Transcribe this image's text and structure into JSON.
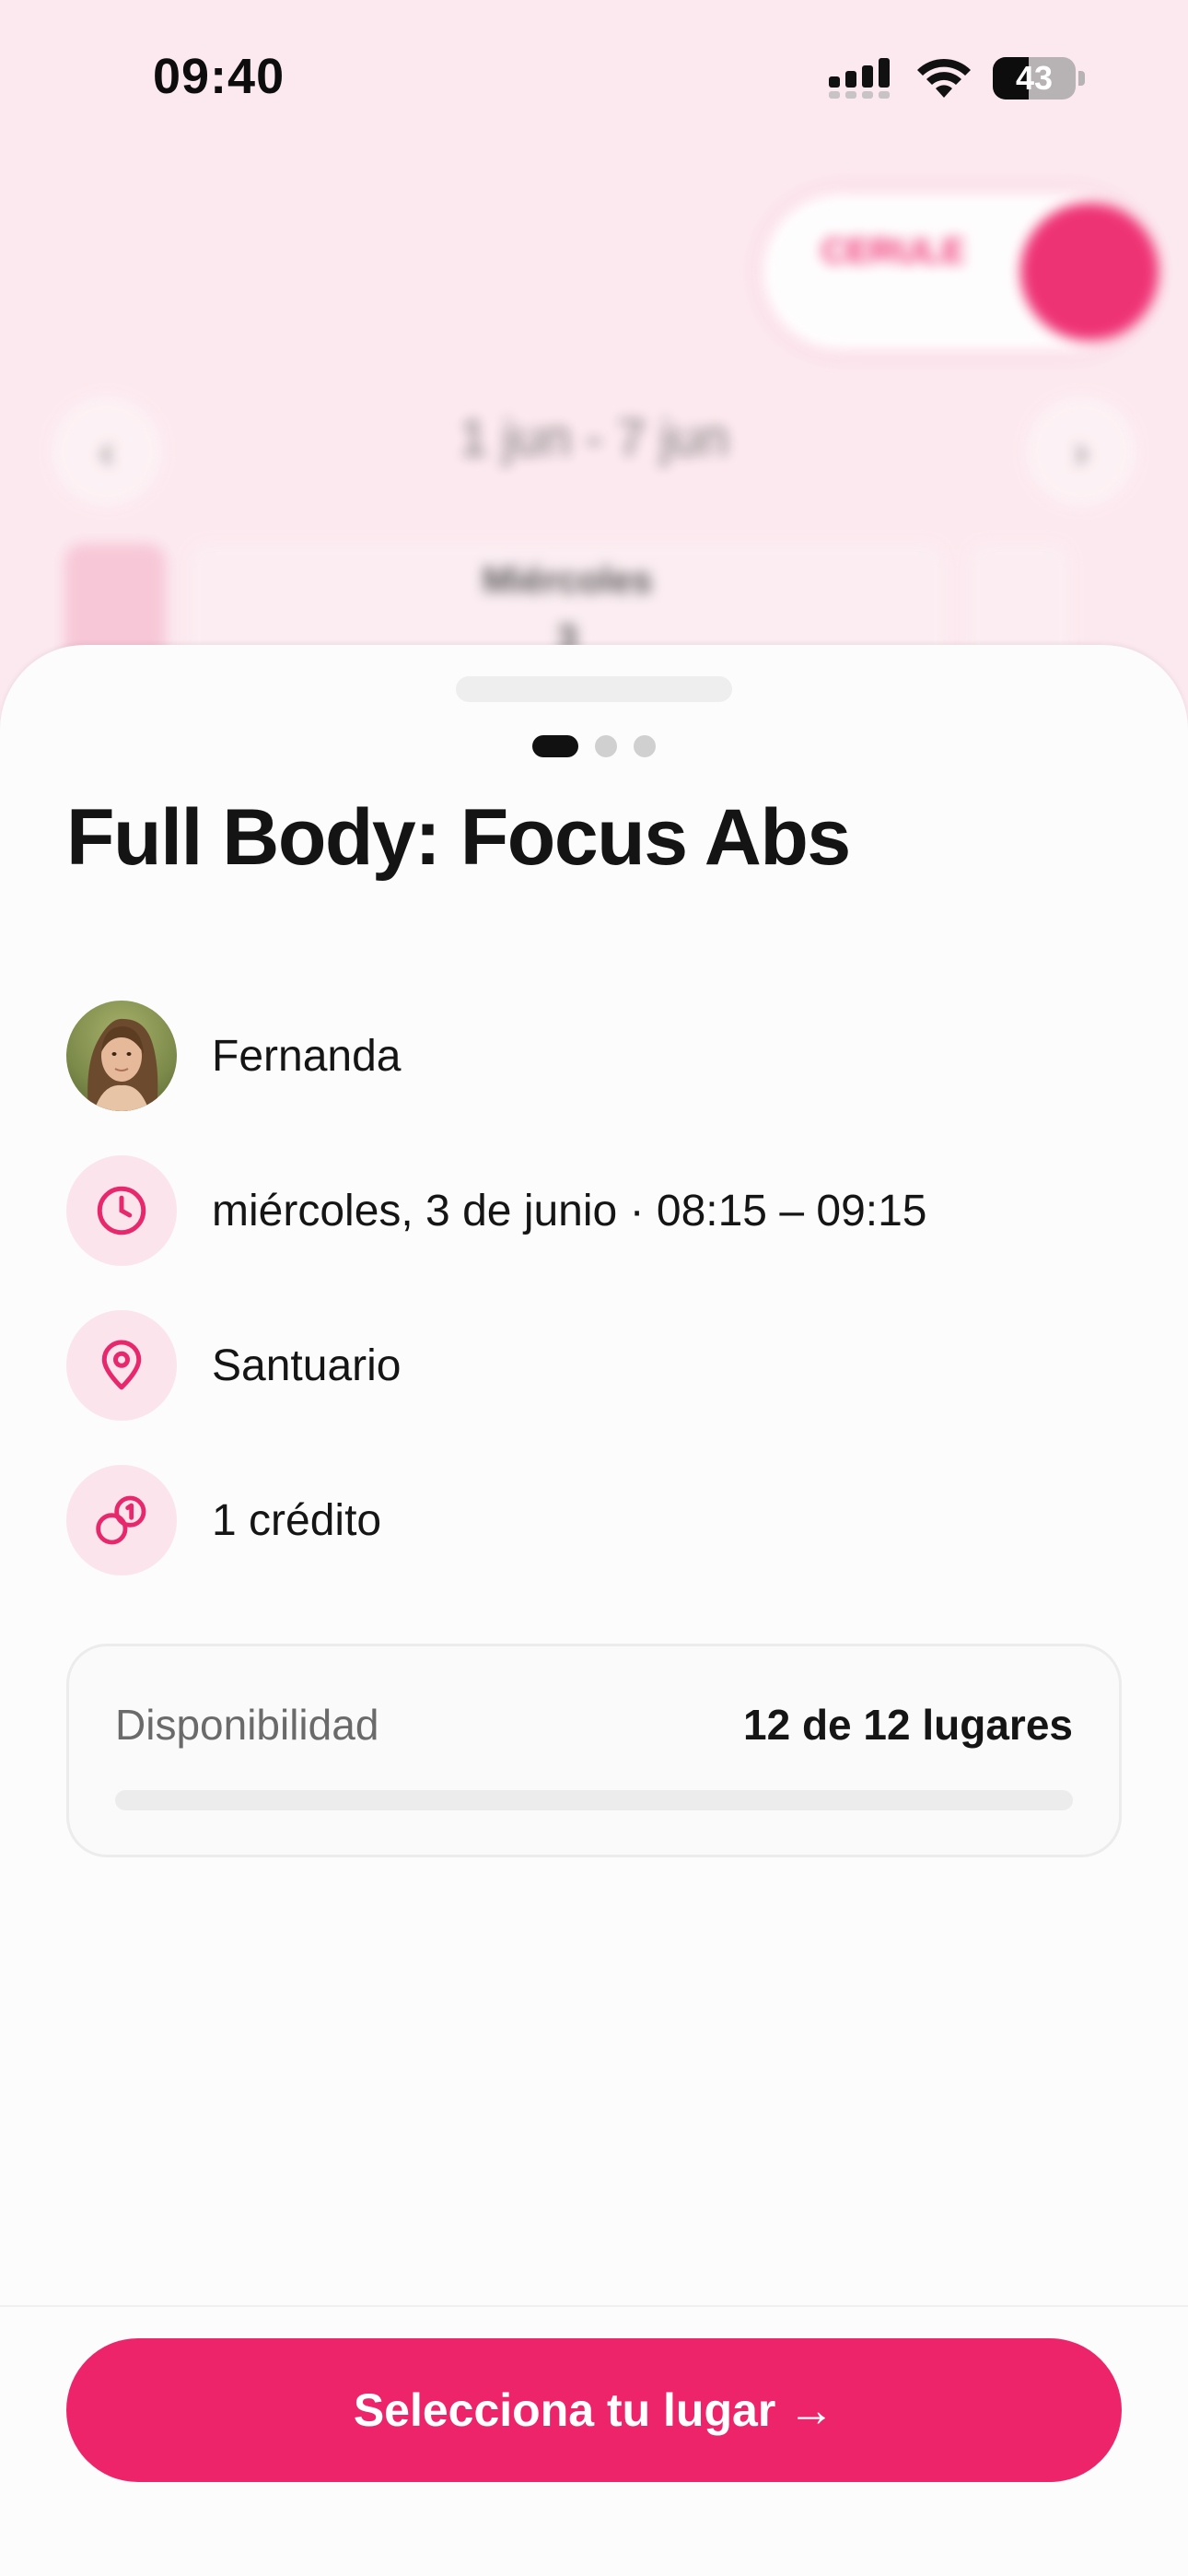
{
  "status_bar": {
    "time": "09:40",
    "battery": "43",
    "battery_level": 0.43,
    "icons": [
      "cellular-signal-icon",
      "wifi-icon",
      "battery-icon"
    ]
  },
  "background": {
    "pill_label": "CERULE",
    "date_range": "1 jun - 7 jun",
    "day_label": "Miércoles",
    "day_number": "3"
  },
  "sheet": {
    "pager": {
      "count": 3,
      "active": 0
    },
    "title": "Full Body: Focus Abs",
    "instructor": "Fernanda",
    "schedule": "miércoles, 3 de junio · 08:15 – 09:15",
    "location": "Santuario",
    "credits": "1 crédito",
    "availability": {
      "label": "Disponibilidad",
      "value": "12 de 12 lugares",
      "fill_fraction": 0
    },
    "cta_label": "Selecciona tu lugar →"
  },
  "colors": {
    "accent": "#ee246b",
    "accent_soft": "#fbe4ec",
    "background_tint": "#fce9ef"
  }
}
